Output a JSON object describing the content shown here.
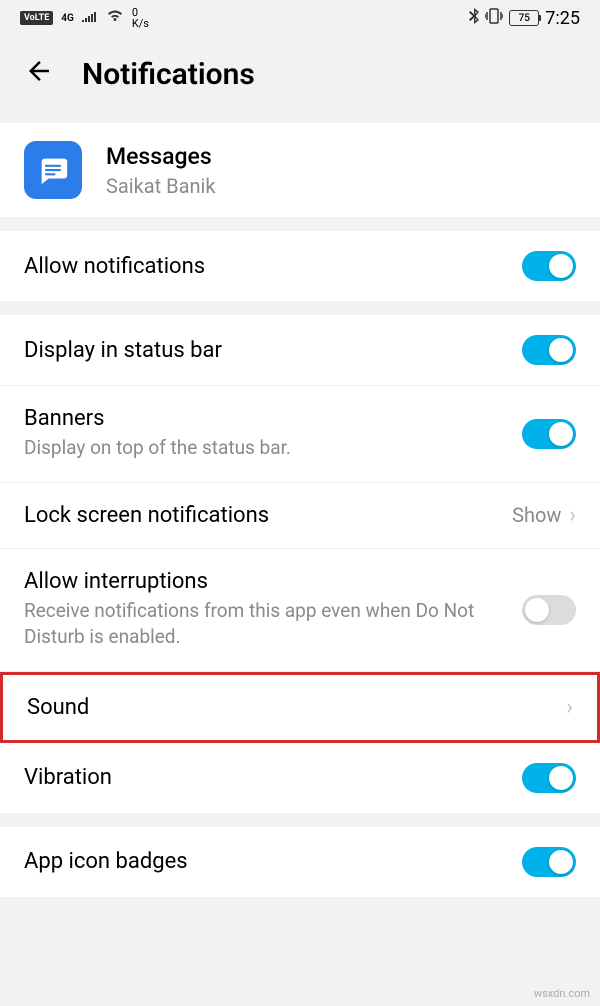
{
  "status": {
    "volte": "VoLTE",
    "network_gen": "4G",
    "speed_top": "0",
    "speed_unit": "K/s",
    "battery": "75",
    "time": "7:25"
  },
  "header": {
    "title": "Notifications"
  },
  "app": {
    "name": "Messages",
    "subtitle": "Saikat Banik"
  },
  "settings": {
    "allow_notifications": {
      "label": "Allow notifications",
      "on": true
    },
    "display_status_bar": {
      "label": "Display in status bar",
      "on": true
    },
    "banners": {
      "label": "Banners",
      "desc": "Display on top of the status bar.",
      "on": true
    },
    "lock_screen": {
      "label": "Lock screen notifications",
      "value": "Show"
    },
    "allow_interruptions": {
      "label": "Allow interruptions",
      "desc": "Receive notifications from this app even when Do Not Disturb is enabled.",
      "on": false
    },
    "sound": {
      "label": "Sound"
    },
    "vibration": {
      "label": "Vibration",
      "on": true
    },
    "app_icon_badges": {
      "label": "App icon badges",
      "on": true
    }
  },
  "watermark": "wsxdn.com"
}
